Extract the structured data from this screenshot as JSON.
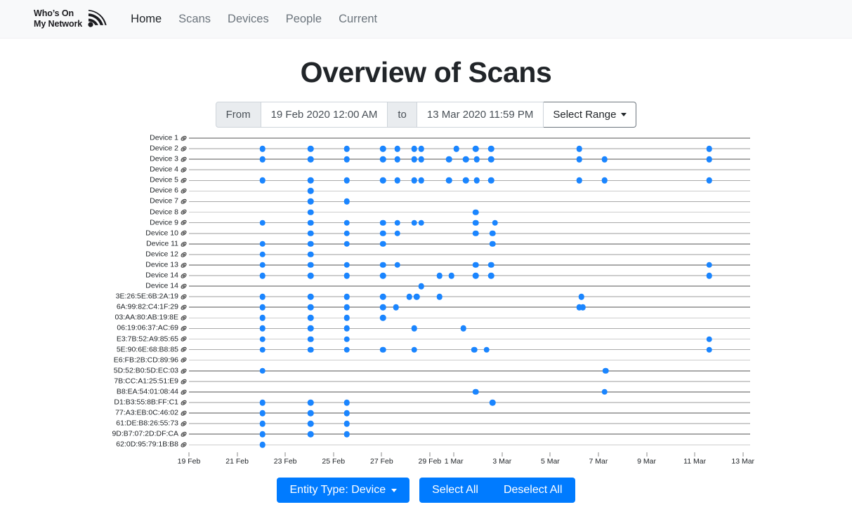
{
  "navbar": {
    "brand_line1": "Who’s On",
    "brand_line2": "My Network",
    "brand_icon": "wifi-signal-icon",
    "links": [
      {
        "label": "Home",
        "active": true
      },
      {
        "label": "Scans",
        "active": false
      },
      {
        "label": "Devices",
        "active": false
      },
      {
        "label": "People",
        "active": false
      },
      {
        "label": "Current",
        "active": false
      }
    ]
  },
  "page": {
    "title": "Overview of Scans"
  },
  "date_range": {
    "from_label": "From",
    "from_value": "19 Feb 2020 12:00 AM",
    "to_label": "to",
    "to_value": "13 Mar 2020 11:59 PM",
    "select_range_label": "Select Range",
    "caret_icon": "chevron-down-icon"
  },
  "footer": {
    "entity_type_label": "Entity Type: Device",
    "entity_caret_icon": "chevron-down-icon",
    "select_all_label": "Select All",
    "deselect_all_label": "Deselect All",
    "accent_color": "#007bff"
  },
  "colors": {
    "dot": "#1a85ff",
    "gridline": "#9a9a9a",
    "navbar_bg": "#f8f9fa",
    "accent": "#007bff"
  },
  "chart_data": {
    "type": "scatter",
    "title": "Overview of Scans",
    "xlabel": "",
    "ylabel": "",
    "grid": true,
    "legend": "none",
    "row_icon": "tag-icon",
    "x_axis": {
      "min": "19 Feb 2020",
      "max": "13 Mar 2020",
      "tick_labels": [
        "19 Feb",
        "21 Feb",
        "23 Feb",
        "25 Feb",
        "27 Feb",
        "29 Feb",
        "1 Mar",
        "3 Mar",
        "5 Mar",
        "7 Mar",
        "9 Mar",
        "11 Mar",
        "13 Mar"
      ],
      "tick_days": [
        0,
        2,
        4,
        6,
        8,
        10,
        11,
        13,
        15,
        17,
        19,
        21,
        23
      ]
    },
    "categories": [
      "Device 1",
      "Device 2",
      "Device 3",
      "Device 4",
      "Device 5",
      "Device 6",
      "Device 7",
      "Device 8",
      "Device 9",
      "Device 10",
      "Device 11",
      "Device 12",
      "Device 13",
      "Device 14",
      "Device 14",
      "3E:26:5E:6B:2A:19",
      "6A:99:82:C4:1F:29",
      "03:AA:80:AB:19:8E",
      "06:19:06:37:AC:69",
      "E3:7B:52:A9:85:65",
      "5E:90:6E:68:B8:85",
      "E6:FB:2B:CD:89:96",
      "5D:52:B0:5D:EC:03",
      "7B:CC:A1:25:51:E9",
      "B8:EA:54:01:08:44",
      "D1:B3:55:8B:FF:C1",
      "77:A3:EB:0C:46:02",
      "61:DE:B8:26:55:73",
      "9D:B7:07:2D:DF:CA",
      "62:0D:95:79:1B:B8"
    ],
    "series": [
      {
        "name": "Device 1",
        "points": []
      },
      {
        "name": "Device 2",
        "points": [
          3.05,
          5.05,
          6.55,
          8.05,
          8.65,
          9.35,
          9.65,
          11.1,
          11.9,
          12.55,
          16.2,
          21.6
        ]
      },
      {
        "name": "Device 3",
        "points": [
          3.05,
          5.05,
          6.55,
          8.05,
          8.65,
          9.35,
          9.65,
          10.8,
          11.5,
          11.95,
          12.55,
          16.2,
          17.25,
          21.6
        ]
      },
      {
        "name": "Device 4",
        "points": []
      },
      {
        "name": "Device 5",
        "points": [
          3.05,
          5.05,
          6.55,
          8.05,
          8.65,
          9.35,
          9.65,
          10.8,
          11.5,
          11.95,
          12.55,
          16.2,
          17.25,
          21.6
        ]
      },
      {
        "name": "Device 6",
        "points": [
          5.05
        ]
      },
      {
        "name": "Device 7",
        "points": [
          5.05,
          6.55
        ]
      },
      {
        "name": "Device 8",
        "points": [
          5.05,
          11.9
        ]
      },
      {
        "name": "Device 9",
        "points": [
          3.05,
          5.05,
          6.55,
          8.05,
          8.65,
          9.35,
          9.65,
          11.9,
          12.7
        ]
      },
      {
        "name": "Device 10",
        "points": [
          5.05,
          6.55,
          8.05,
          8.65,
          11.9,
          12.6
        ]
      },
      {
        "name": "Device 11",
        "points": [
          3.05,
          5.05,
          6.55,
          8.05,
          12.6
        ]
      },
      {
        "name": "Device 12",
        "points": [
          3.05,
          5.05
        ]
      },
      {
        "name": "Device 13",
        "points": [
          3.05,
          5.05,
          6.55,
          8.05,
          8.65,
          11.9,
          12.55,
          21.6
        ]
      },
      {
        "name": "Device 14",
        "points": [
          3.05,
          5.05,
          6.55,
          8.05,
          10.4,
          10.9,
          11.9,
          12.55,
          21.6
        ]
      },
      {
        "name": "Device 14",
        "points": [
          9.65
        ]
      },
      {
        "name": "3E:26:5E:6B:2A:19",
        "points": [
          3.05,
          5.05,
          6.55,
          8.05,
          9.15,
          9.45,
          10.4,
          16.3
        ]
      },
      {
        "name": "6A:99:82:C4:1F:29",
        "points": [
          3.05,
          5.05,
          6.55,
          8.05,
          8.6,
          16.2,
          16.35
        ]
      },
      {
        "name": "03:AA:80:AB:19:8E",
        "points": [
          3.05,
          5.05,
          6.55,
          8.05
        ]
      },
      {
        "name": "06:19:06:37:AC:69",
        "points": [
          3.05,
          5.05,
          6.55,
          9.35,
          11.4
        ]
      },
      {
        "name": "E3:7B:52:A9:85:65",
        "points": [
          3.05,
          5.05,
          6.55,
          21.6
        ]
      },
      {
        "name": "5E:90:6E:68:B8:85",
        "points": [
          3.05,
          5.05,
          6.55,
          8.05,
          9.35,
          11.85,
          12.35,
          21.6
        ]
      },
      {
        "name": "E6:FB:2B:CD:89:96",
        "points": []
      },
      {
        "name": "5D:52:B0:5D:EC:03",
        "points": [
          3.05,
          17.3
        ]
      },
      {
        "name": "7B:CC:A1:25:51:E9",
        "points": []
      },
      {
        "name": "B8:EA:54:01:08:44",
        "points": [
          11.9,
          17.25
        ]
      },
      {
        "name": "D1:B3:55:8B:FF:C1",
        "points": [
          3.05,
          5.05,
          6.55,
          12.6
        ]
      },
      {
        "name": "77:A3:EB:0C:46:02",
        "points": [
          3.05,
          5.05,
          6.55
        ]
      },
      {
        "name": "61:DE:B8:26:55:73",
        "points": [
          3.05,
          5.05,
          6.55
        ]
      },
      {
        "name": "9D:B7:07:2D:DF:CA",
        "points": [
          3.05,
          5.05,
          6.55
        ]
      },
      {
        "name": "62:0D:95:79:1B:B8",
        "points": [
          3.05
        ]
      }
    ]
  }
}
